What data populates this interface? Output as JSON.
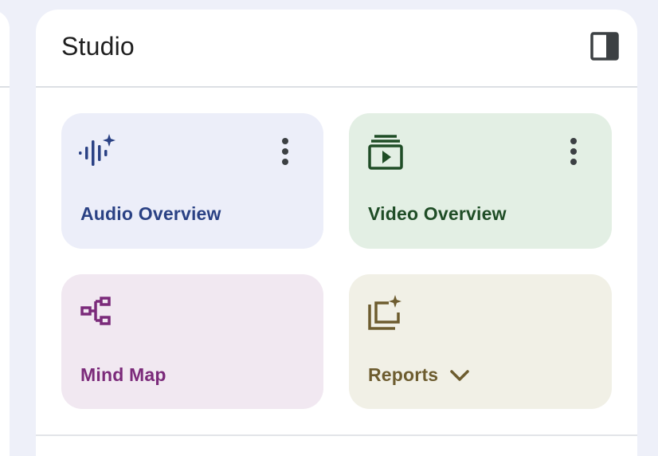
{
  "panel": {
    "title": "Studio",
    "collapse_icon": "side-panel-icon"
  },
  "tiles": [
    {
      "label": "Audio Overview",
      "icon": "audio-waveform-sparkle-icon",
      "has_menu": true,
      "color": "#2a4184",
      "background": "#eceef9"
    },
    {
      "label": "Video Overview",
      "icon": "video-play-stack-icon",
      "has_menu": true,
      "color": "#1f4d26",
      "background": "#e3efe4"
    },
    {
      "label": "Mind Map",
      "icon": "mind-map-icon",
      "has_menu": false,
      "color": "#7b2a7a",
      "background": "#f1e8f1"
    },
    {
      "label": "Reports",
      "icon": "reports-sparkle-icon",
      "has_menu": false,
      "has_dropdown": true,
      "color": "#6d5c2f",
      "background": "#f1f0e6"
    }
  ],
  "colors": {
    "page_background": "#eef0f9",
    "panel_background": "#ffffff",
    "divider": "#dcdfe4"
  }
}
